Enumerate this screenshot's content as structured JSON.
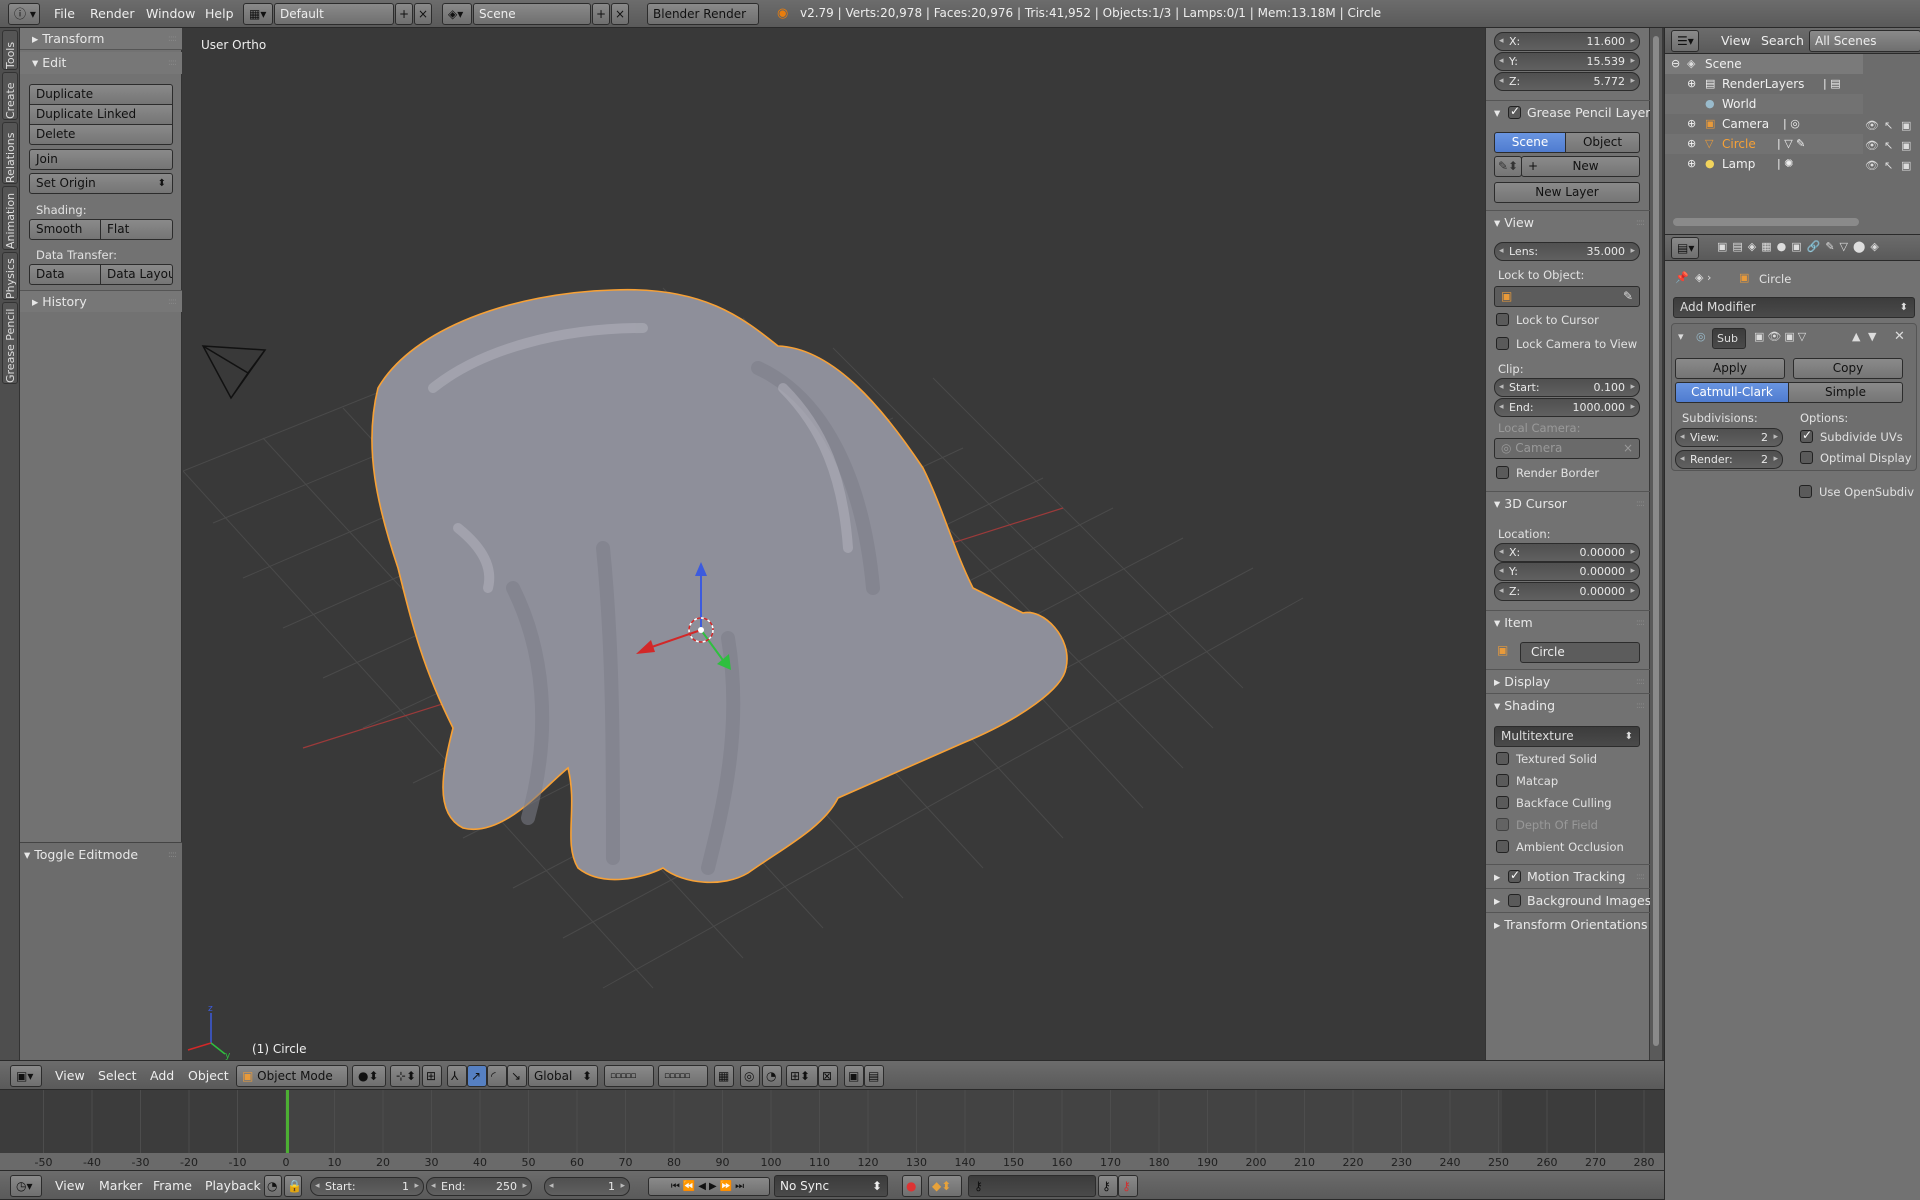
{
  "topbar": {
    "menu": [
      "File",
      "Render",
      "Window",
      "Help"
    ],
    "layout": "Default",
    "scene": "Scene",
    "engine": "Blender Render",
    "stats": "v2.79 | Verts:20,978 | Faces:20,976 | Tris:41,952 | Objects:1/3 | Lamps:0/1 | Mem:13.18M | Circle"
  },
  "tool_tabs": [
    "Tools",
    "Create",
    "Relations",
    "Animation",
    "Physics",
    "Grease Pencil"
  ],
  "tools": {
    "transform": "Transform",
    "edit": "Edit",
    "duplicate": "Duplicate",
    "duplicate_linked": "Duplicate Linked",
    "delete": "Delete",
    "join": "Join",
    "set_origin": "Set Origin",
    "shading": "Shading:",
    "smooth": "Smooth",
    "flat": "Flat",
    "data_transfer": "Data Transfer:",
    "data": "Data",
    "data_layout": "Data Layout",
    "history": "History",
    "toggle_editmode": "Toggle Editmode"
  },
  "viewport": {
    "view_name": "User Ortho",
    "object_label": "(1) Circle"
  },
  "props": {
    "x_label": "X:",
    "x": "11.600",
    "y_label": "Y:",
    "y": "15.539",
    "z_label": "Z:",
    "z": "5.772",
    "gp_layers": "Grease Pencil Layers",
    "scene": "Scene",
    "object": "Object",
    "new": "New",
    "new_layer": "New Layer",
    "view": "View",
    "lens_label": "Lens:",
    "lens": "35.000",
    "lock_to_object": "Lock to Object:",
    "lock_to_cursor": "Lock to Cursor",
    "lock_camera": "Lock Camera to View",
    "clip": "Clip:",
    "start_label": "Start:",
    "start": "0.100",
    "end_label": "End:",
    "end": "1000.000",
    "local_camera": "Local Camera:",
    "camera": "Camera",
    "render_border": "Render Border",
    "cursor": "3D Cursor",
    "location": "Location:",
    "cx_label": "X:",
    "cx": "0.00000",
    "cy_label": "Y:",
    "cy": "0.00000",
    "cz_label": "Z:",
    "cz": "0.00000",
    "item": "Item",
    "item_name": "Circle",
    "display": "Display",
    "shading": "Shading",
    "shading_mode": "Multitexture",
    "textured_solid": "Textured Solid",
    "matcap": "Matcap",
    "backface": "Backface Culling",
    "dof": "Depth Of Field",
    "ao": "Ambient Occlusion",
    "motion_tracking": "Motion Tracking",
    "background_images": "Background Images",
    "transform_orientations": "Transform Orientations"
  },
  "outliner": {
    "view": "View",
    "search": "Search",
    "all_scenes": "All Scenes",
    "items": [
      "Scene",
      "RenderLayers",
      "World",
      "Camera",
      "Circle",
      "Lamp"
    ]
  },
  "modifier": {
    "object": "Circle",
    "add_modifier": "Add Modifier",
    "name": "Sub",
    "apply": "Apply",
    "copy": "Copy",
    "catmull": "Catmull-Clark",
    "simple": "Simple",
    "subdivisions": "Subdivisions:",
    "options": "Options:",
    "view_label": "View:",
    "view": "2",
    "render_label": "Render:",
    "render": "2",
    "subdivide_uvs": "Subdivide UVs",
    "optimal_display": "Optimal Display",
    "use_opensubdiv": "Use OpenSubdiv"
  },
  "view3d_header": {
    "view": "View",
    "select": "Select",
    "add": "Add",
    "object": "Object",
    "mode": "Object Mode",
    "orientation": "Global"
  },
  "timeline": {
    "ticks": [
      -50,
      -40,
      -30,
      -20,
      -10,
      0,
      10,
      20,
      30,
      40,
      50,
      60,
      70,
      80,
      90,
      100,
      110,
      120,
      130,
      140,
      150,
      160,
      170,
      180,
      190,
      200,
      210,
      220,
      230,
      240,
      250,
      260,
      270,
      280
    ],
    "current": 0
  },
  "timeline_header": {
    "view": "View",
    "marker": "Marker",
    "frame": "Frame",
    "playback": "Playback",
    "start_label": "Start:",
    "start": "1",
    "end_label": "End:",
    "end": "250",
    "current": "1",
    "sync": "No Sync"
  },
  "colors": {
    "selection": "#f7a136",
    "accent": "#5680c2"
  }
}
